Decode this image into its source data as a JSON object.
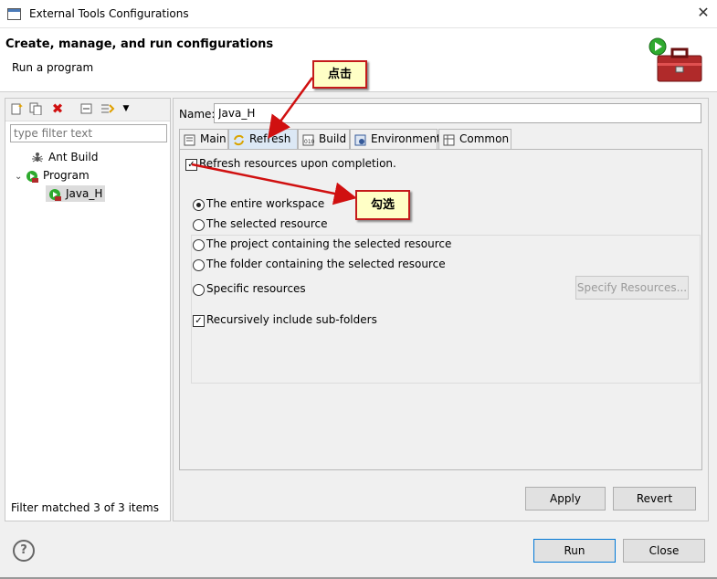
{
  "window": {
    "title": "External Tools Configurations"
  },
  "header": {
    "title": "Create, manage, and run configurations",
    "subtitle": "Run a program"
  },
  "left": {
    "filter_placeholder": "type filter text",
    "tree": [
      {
        "label": "Ant Build",
        "level": 1
      },
      {
        "label": "Program",
        "level": 1
      },
      {
        "label": "Java_H",
        "level": 2
      }
    ],
    "status": "Filter matched 3 of 3 items"
  },
  "right": {
    "name_label": "Name:",
    "name_value": "Java_H",
    "tabs": [
      "Main",
      "Refresh",
      "Build",
      "Environment",
      "Common"
    ],
    "active_tab": "Refresh",
    "refresh_checkbox": "Refresh resources upon completion.",
    "options": [
      "The entire workspace",
      "The selected resource",
      "The project containing the selected resource",
      "The folder containing the selected resource",
      "Specific resources"
    ],
    "selected_option": "The entire workspace",
    "specify_button": "Specify Resources...",
    "recursive_checkbox": "Recursively include sub-folders",
    "apply": "Apply",
    "revert": "Revert"
  },
  "footer": {
    "help": "?",
    "run": "Run",
    "close": "Close"
  },
  "annotations": {
    "click": "点击",
    "check": "勾选"
  },
  "colors": {
    "annotation_red": "#d01010",
    "callout_bg": "#ffffc6",
    "accent": "#0078d7"
  }
}
